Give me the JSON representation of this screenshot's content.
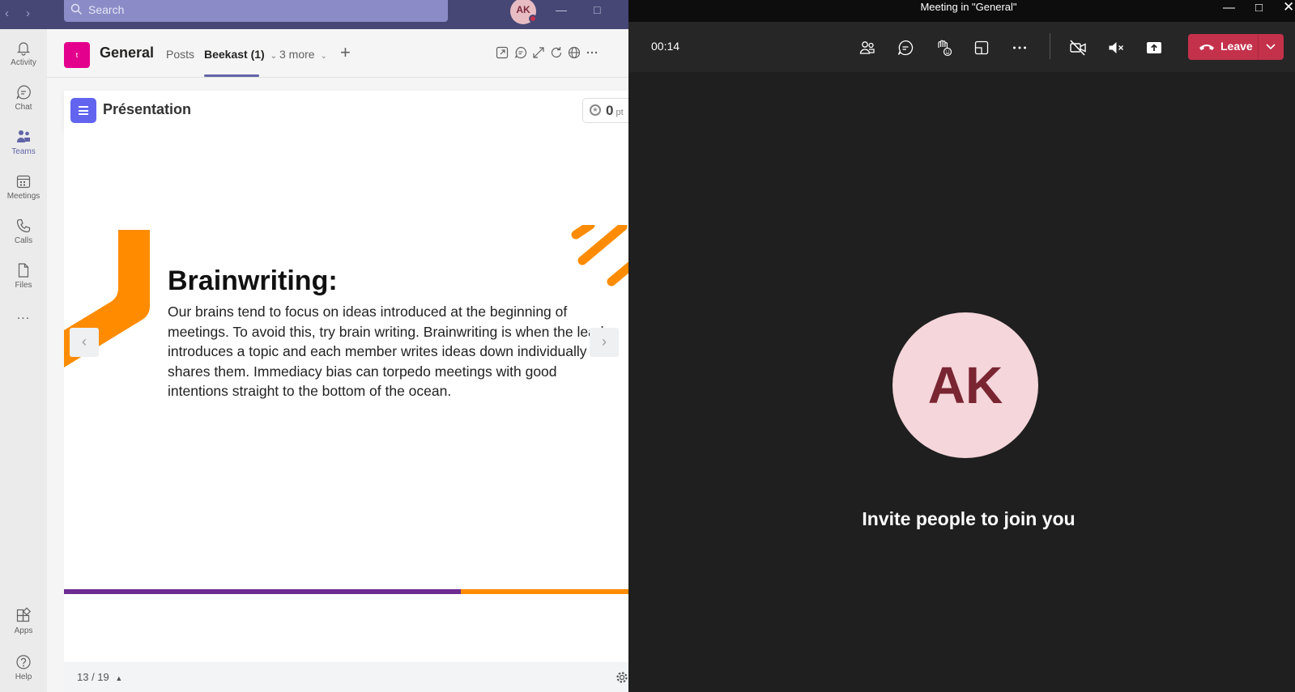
{
  "teams": {
    "search": {
      "placeholder": "Search"
    },
    "user_initials": "AK",
    "rail": {
      "items": [
        {
          "label": "Activity",
          "icon": "bell-icon"
        },
        {
          "label": "Chat",
          "icon": "chat-icon"
        },
        {
          "label": "Teams",
          "icon": "teams-icon"
        },
        {
          "label": "Meetings",
          "icon": "calendar-icon"
        },
        {
          "label": "Calls",
          "icon": "phone-icon"
        },
        {
          "label": "Files",
          "icon": "file-icon"
        }
      ],
      "more": "...",
      "apps": "Apps",
      "help": "Help"
    },
    "header": {
      "team_tile": "t",
      "channel": "General",
      "tabs": [
        {
          "label": "Posts"
        },
        {
          "label": "Beekast (1)"
        },
        {
          "label": "3 more"
        }
      ]
    },
    "app": {
      "title": "Présentation",
      "points_value": "0",
      "points_unit": "pt"
    },
    "slide": {
      "title": "Brainwriting:",
      "body": "Our brains tend to focus on ideas introduced at the beginning of meetings. To avoid this, try brain writing. Brainwriting is when the leader introduces a topic and each member writes ideas down individually and shares them. Immediacy bias can torpedo meetings with good intentions straight to the bottom of the ocean.",
      "page": "13 / 19"
    },
    "colors": {
      "purple": "#464775",
      "accent": "#6264a7",
      "orange": "#ff8c00",
      "slide_purple": "#6c2c91"
    }
  },
  "meeting": {
    "title": "Meeting in \"General\"",
    "timer": "00:14",
    "leave_label": "Leave",
    "avatar_initials": "AK",
    "invite_text": "Invite people to join you",
    "colors": {
      "leave": "#c4314b",
      "background": "#1f1f1f"
    }
  }
}
